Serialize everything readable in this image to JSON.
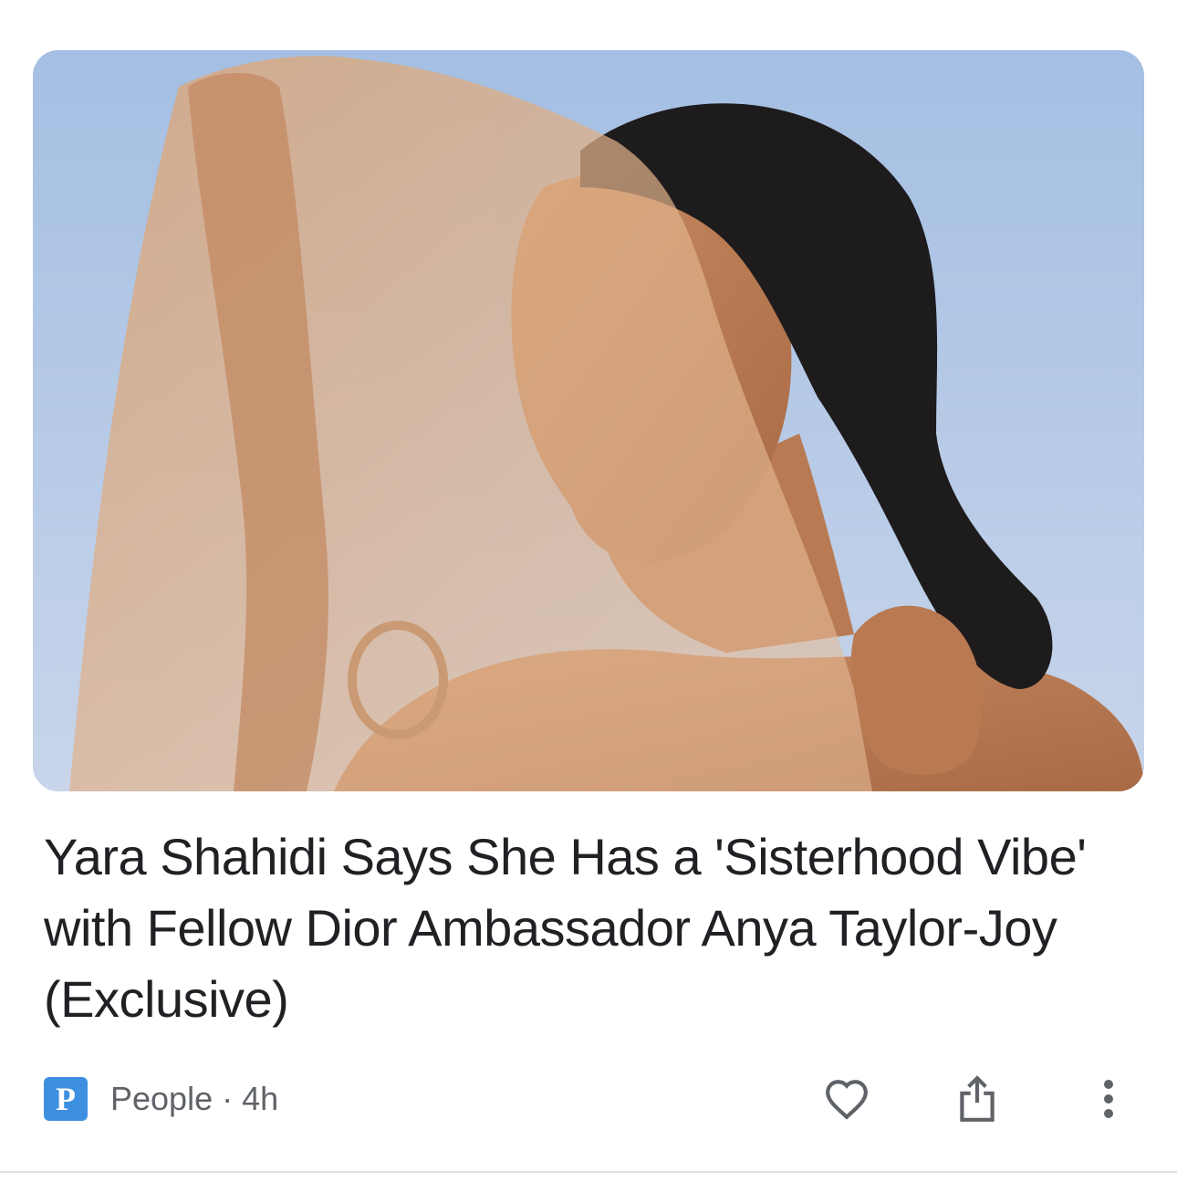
{
  "article": {
    "image_alt": "Yara Shahidi",
    "headline": "Yara Shahidi Says She Has a 'Sisterhood Vibe' with Fellow Dior Ambassador Anya Taylor-Joy (Exclusive)",
    "source": {
      "logo_letter": "P",
      "name": "People",
      "separator": "·",
      "age": "4h"
    },
    "actions": {
      "like_icon": "heart-outline-icon",
      "share_icon": "share-icon",
      "more_icon": "more-vertical-icon"
    }
  },
  "colors": {
    "headline_text": "#202124",
    "meta_text": "#5f6368",
    "logo_bg": "#3d8fe0",
    "divider": "#e0e0e0"
  }
}
